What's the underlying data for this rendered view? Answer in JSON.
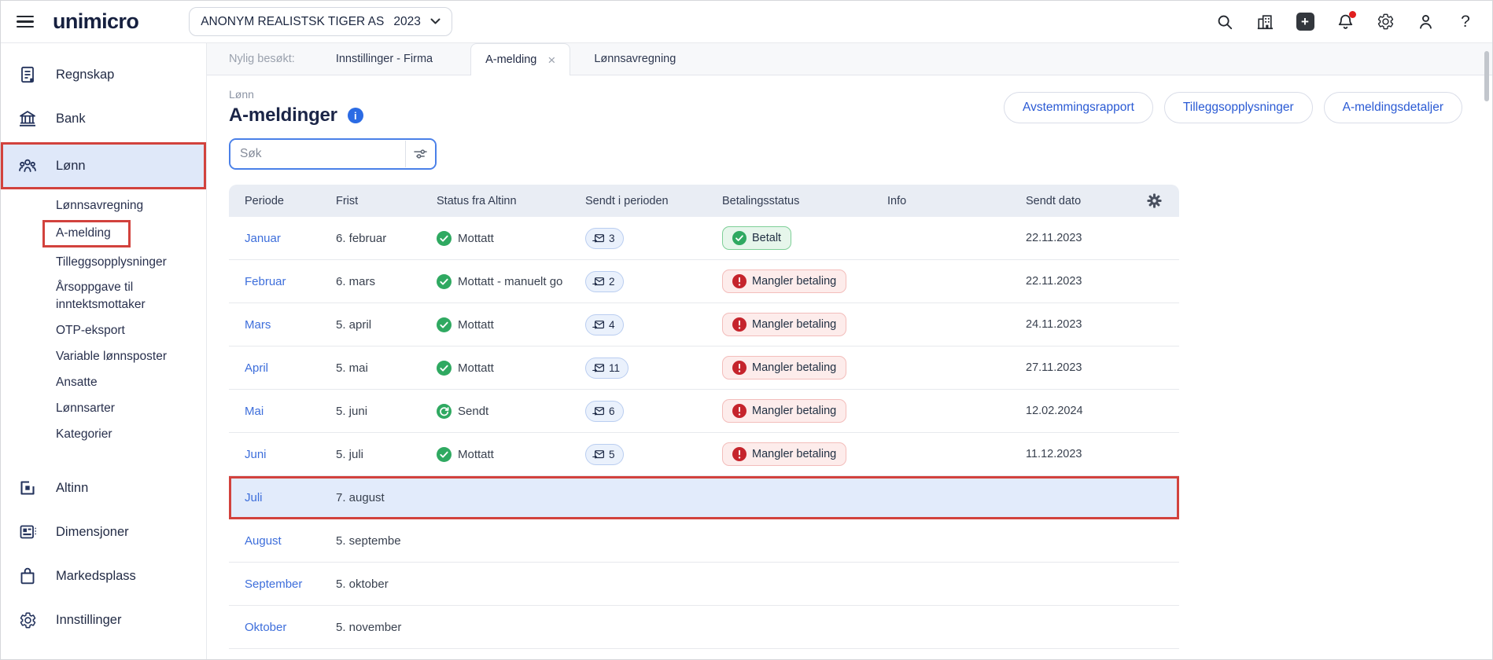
{
  "topbar": {
    "logo": "unimicro",
    "company_selector": {
      "company": "ANONYM REALISTSK TIGER AS",
      "year": "2023"
    },
    "plus_glyph": "+",
    "help_glyph": "?"
  },
  "tab_bar": {
    "recent_label": "Nylig besøkt:",
    "tab_settings_firma": "Innstillinger - Firma",
    "tab_amelding": "A-melding",
    "close_glyph": "×",
    "tab_lonnsavregning": "Lønnsavregning"
  },
  "page_header": {
    "breadcrumb": "Lønn",
    "title": "A-meldinger",
    "info_glyph": "i",
    "actions": {
      "avstemmingsrapport": "Avstemmingsrapport",
      "tilleggsopplysninger": "Tilleggsopplysninger",
      "ameldingsdetaljer": "A-meldingsdetaljer"
    }
  },
  "sidebar": {
    "items": [
      {
        "label": "Regnskap",
        "icon": "ledger-icon"
      },
      {
        "label": "Bank",
        "icon": "bank-icon"
      },
      {
        "label": "Lønn",
        "icon": "people-icon",
        "active": true,
        "annotated": true
      },
      {
        "label": "Lønnsavregning",
        "sub": true
      },
      {
        "label": "A-melding",
        "sub": true,
        "annotated": true
      },
      {
        "label": "Tilleggsopplysninger",
        "sub": true
      },
      {
        "label": "Årsoppgave til inntektsmottaker",
        "sub": true
      },
      {
        "label": "OTP-eksport",
        "sub": true
      },
      {
        "label": "Variable lønnsposter",
        "sub": true
      },
      {
        "label": "Ansatte",
        "sub": true
      },
      {
        "label": "Lønnsarter",
        "sub": true
      },
      {
        "label": "Kategorier",
        "sub": true
      },
      {
        "label": "Altinn",
        "icon": "altinn-icon"
      },
      {
        "label": "Dimensjoner",
        "icon": "dimensions-icon"
      },
      {
        "label": "Markedsplass",
        "icon": "marketplace-icon"
      },
      {
        "label": "Innstillinger",
        "icon": "settings-icon"
      }
    ]
  },
  "search": {
    "placeholder": "Søk"
  },
  "table": {
    "columns": {
      "periode": "Periode",
      "frist": "Frist",
      "status": "Status fra Altinn",
      "sendt": "Sendt i perioden",
      "betaling": "Betalingsstatus",
      "info": "Info",
      "dato": "Sendt dato"
    },
    "rows": [
      {
        "period": "Januar",
        "frist": "6. februar",
        "status": "Mottatt",
        "sent_count": "3",
        "payment": "Betalt",
        "date": "22.11.2023"
      },
      {
        "period": "Februar",
        "frist": "6. mars",
        "status": "Mottatt - manuelt go",
        "sent_count": "2",
        "payment": "Mangler betaling",
        "date": "22.11.2023"
      },
      {
        "period": "Mars",
        "frist": "5. april",
        "status": "Mottatt",
        "sent_count": "4",
        "payment": "Mangler betaling",
        "date": "24.11.2023"
      },
      {
        "period": "April",
        "frist": "5. mai",
        "status": "Mottatt",
        "sent_count": "11",
        "payment": "Mangler betaling",
        "date": "27.11.2023"
      },
      {
        "period": "Mai",
        "frist": "5. juni",
        "status": "Sendt",
        "sent_count": "6",
        "payment": "Mangler betaling",
        "date": "12.02.2024"
      },
      {
        "period": "Juni",
        "frist": "5. juli",
        "status": "Mottatt",
        "sent_count": "5",
        "payment": "Mangler betaling",
        "date": "11.12.2023"
      },
      {
        "period": "Juli",
        "frist": "7. august"
      },
      {
        "period": "August",
        "frist": "5. septembe"
      },
      {
        "period": "September",
        "frist": "5. oktober"
      },
      {
        "period": "Oktober",
        "frist": "5. november"
      }
    ]
  },
  "colors": {
    "accent_blue": "#3d6edb",
    "success_green": "#2fa961",
    "error_red": "#c5242c",
    "annotation_red": "#d2423d",
    "brand_navy": "#1b2547",
    "active_item_bg": "#dfe8f9",
    "table_header_bg": "#e9edf4"
  }
}
